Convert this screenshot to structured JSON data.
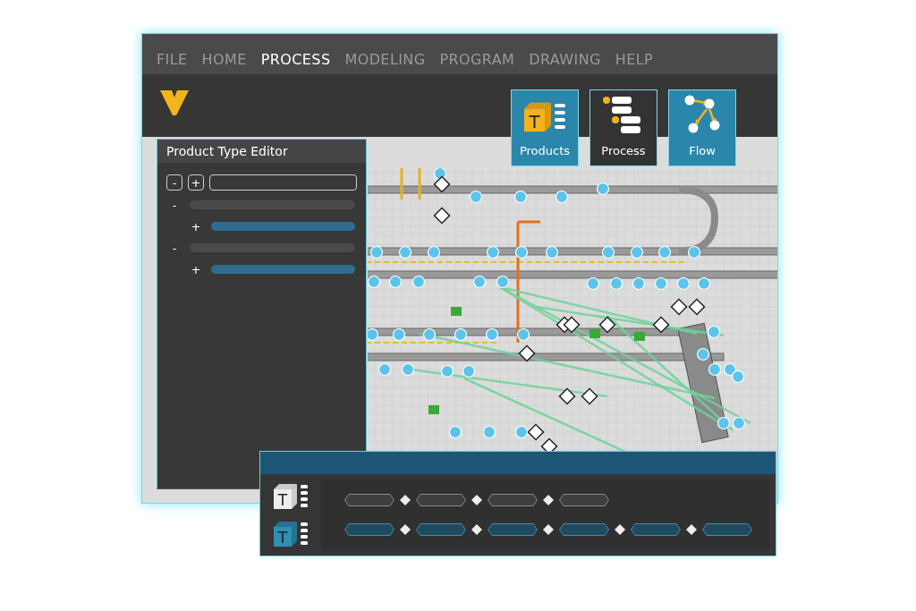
{
  "menu": [
    {
      "label": "FILE",
      "selected": false
    },
    {
      "label": "HOME",
      "selected": false
    },
    {
      "label": "PROCESS",
      "selected": true
    },
    {
      "label": "MODELING",
      "selected": false
    },
    {
      "label": "PROGRAM",
      "selected": false
    },
    {
      "label": "DRAWING",
      "selected": false
    },
    {
      "label": "HELP",
      "selected": false
    }
  ],
  "ribbon": [
    {
      "kind": "products",
      "label": "Products",
      "selected": true,
      "icon_letter": "T"
    },
    {
      "kind": "process",
      "label": "Process",
      "selected": false
    },
    {
      "kind": "flow",
      "label": "Flow",
      "selected": true
    }
  ],
  "product_type_editor": {
    "title": "Product Type Editor",
    "toolbar": [
      "-",
      "+"
    ],
    "tree": [
      {
        "toggle": "-",
        "children": [
          {
            "toggle": "+"
          }
        ]
      },
      {
        "toggle": "-",
        "children": [
          {
            "toggle": "+"
          }
        ]
      }
    ]
  },
  "sequence_panel": {
    "rows": [
      {
        "selected": false,
        "icon_letter": "T",
        "steps": [
          {
            "kind": "step"
          },
          {
            "kind": "step"
          },
          {
            "kind": "step"
          },
          {
            "kind": "step"
          }
        ]
      },
      {
        "selected": true,
        "icon_letter": "T",
        "steps": [
          {
            "kind": "step"
          },
          {
            "kind": "step"
          },
          {
            "kind": "step"
          },
          {
            "kind": "step"
          },
          {
            "kind": "step"
          },
          {
            "kind": "step"
          }
        ]
      }
    ]
  }
}
